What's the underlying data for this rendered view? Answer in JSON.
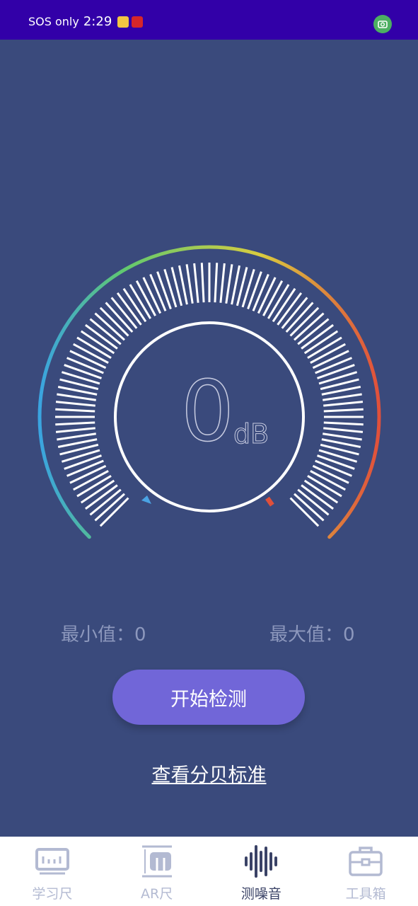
{
  "status_bar": {
    "sos_text": "SOS only",
    "time": "2:29",
    "icons": [
      "notification-yellow-icon",
      "notification-red-icon",
      "camera-icon"
    ]
  },
  "meter": {
    "value": "0",
    "unit": "dB"
  },
  "stats": {
    "min_label": "最小值：0",
    "max_label": "最大值：0"
  },
  "actions": {
    "start_label": "开始检测",
    "standard_link": "查看分贝标准"
  },
  "bottom_nav": {
    "items": [
      {
        "label": "学习尺",
        "icon": "ruler-icon"
      },
      {
        "label": "AR尺",
        "icon": "ar-ruler-icon"
      },
      {
        "label": "测噪音",
        "icon": "sound-wave-icon",
        "active": true
      },
      {
        "label": "工具箱",
        "icon": "toolbox-icon"
      }
    ]
  },
  "colors": {
    "background": "#3a4a7c",
    "status_bar": "#3200a8",
    "button": "#7166d8",
    "gauge_gradient": [
      "#3aa4e0",
      "#61c96e",
      "#d9cc3f",
      "#e0503b"
    ]
  }
}
